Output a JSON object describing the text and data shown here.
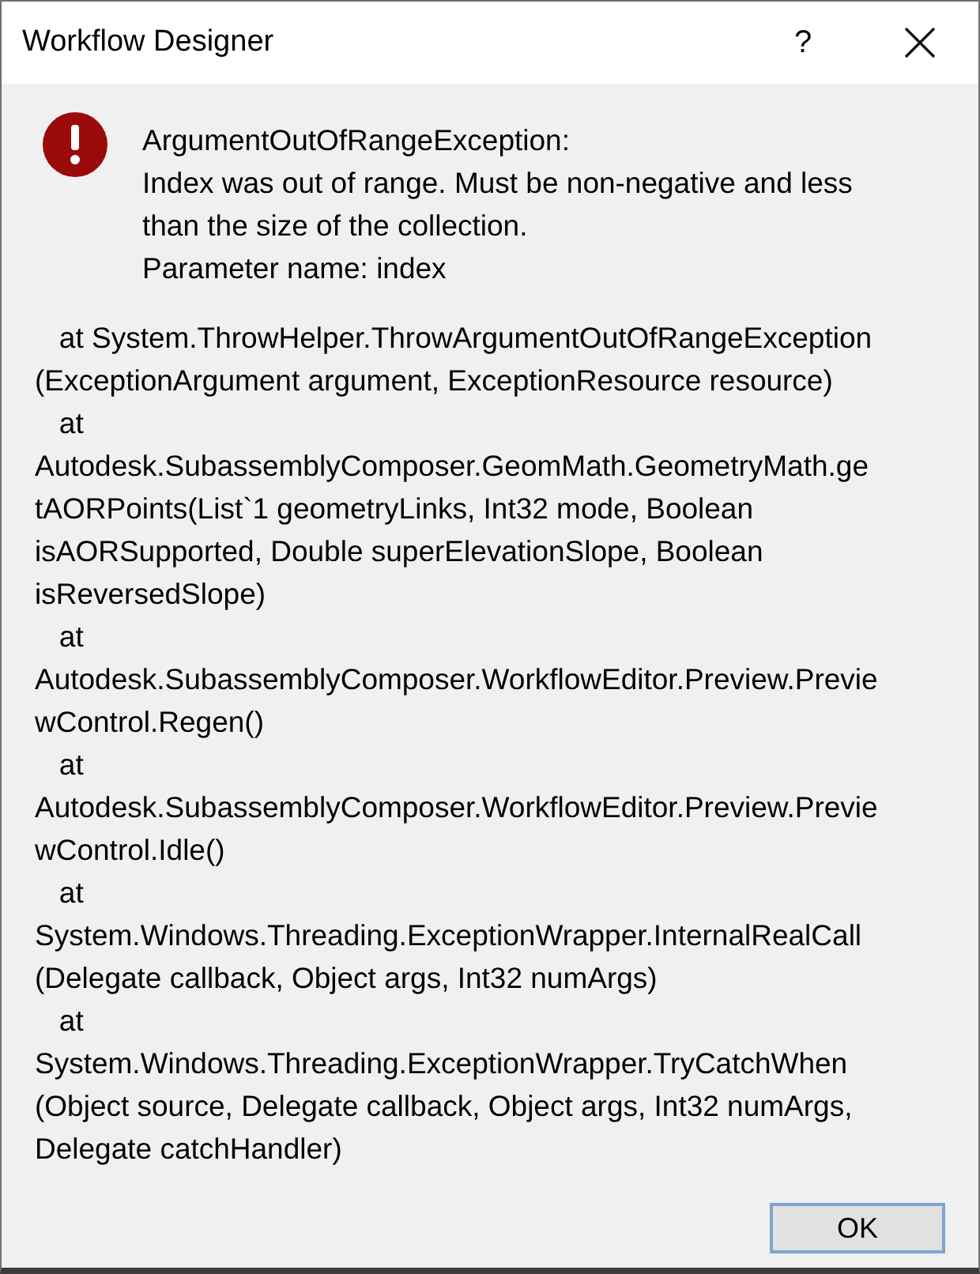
{
  "window": {
    "title": "Workflow Designer",
    "help_button": "?"
  },
  "error": {
    "message_lines": [
      "ArgumentOutOfRangeException:",
      "Index was out of range. Must be non-negative and less",
      "than the size of the collection.",
      "Parameter name: index"
    ],
    "stack_trace_lines": [
      "   at System.ThrowHelper.ThrowArgumentOutOfRangeException",
      "(ExceptionArgument argument, ExceptionResource resource)",
      "   at",
      "Autodesk.SubassemblyComposer.GeomMath.GeometryMath.ge",
      "tAORPoints(List`1 geometryLinks, Int32 mode, Boolean",
      "isAORSupported, Double superElevationSlope, Boolean",
      "isReversedSlope)",
      "   at",
      "Autodesk.SubassemblyComposer.WorkflowEditor.Preview.Previe",
      "wControl.Regen()",
      "   at",
      "Autodesk.SubassemblyComposer.WorkflowEditor.Preview.Previe",
      "wControl.Idle()",
      "   at",
      "System.Windows.Threading.ExceptionWrapper.InternalRealCall",
      "(Delegate callback, Object args, Int32 numArgs)",
      "   at",
      "System.Windows.Threading.ExceptionWrapper.TryCatchWhen",
      "(Object source, Delegate callback, Object args, Int32 numArgs,",
      "Delegate catchHandler)"
    ]
  },
  "buttons": [
    {
      "label": "OK",
      "default": true
    }
  ]
}
